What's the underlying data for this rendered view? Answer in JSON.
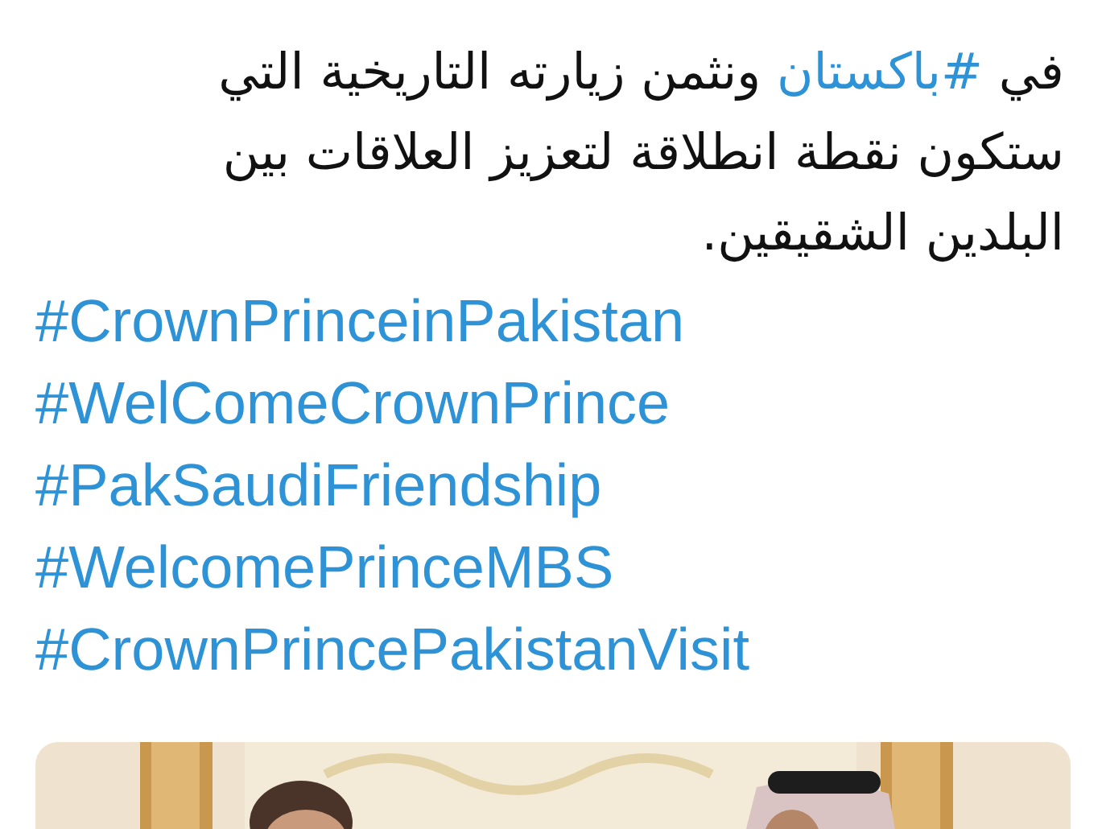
{
  "tweet": {
    "body_lines": [
      [
        {
          "kind": "text",
          "text": "في "
        },
        {
          "kind": "hashtag",
          "text": "#باكستان"
        },
        {
          "kind": "text",
          "text": " ونثمن زيارته التاريخية التي"
        }
      ],
      [
        {
          "kind": "text",
          "text": "ستكون نقطة انطلاقة لتعزيز العلاقات بين"
        }
      ],
      [
        {
          "kind": "text",
          "text": "البلدين الشقيقين."
        }
      ]
    ],
    "hashtags": [
      "#CrownPrinceinPakistan",
      "#WelComeCrownPrince",
      "#PakSaudiFriendship",
      "#WelcomePrinceMBS",
      "#CrownPrincePakistanVisit"
    ]
  }
}
